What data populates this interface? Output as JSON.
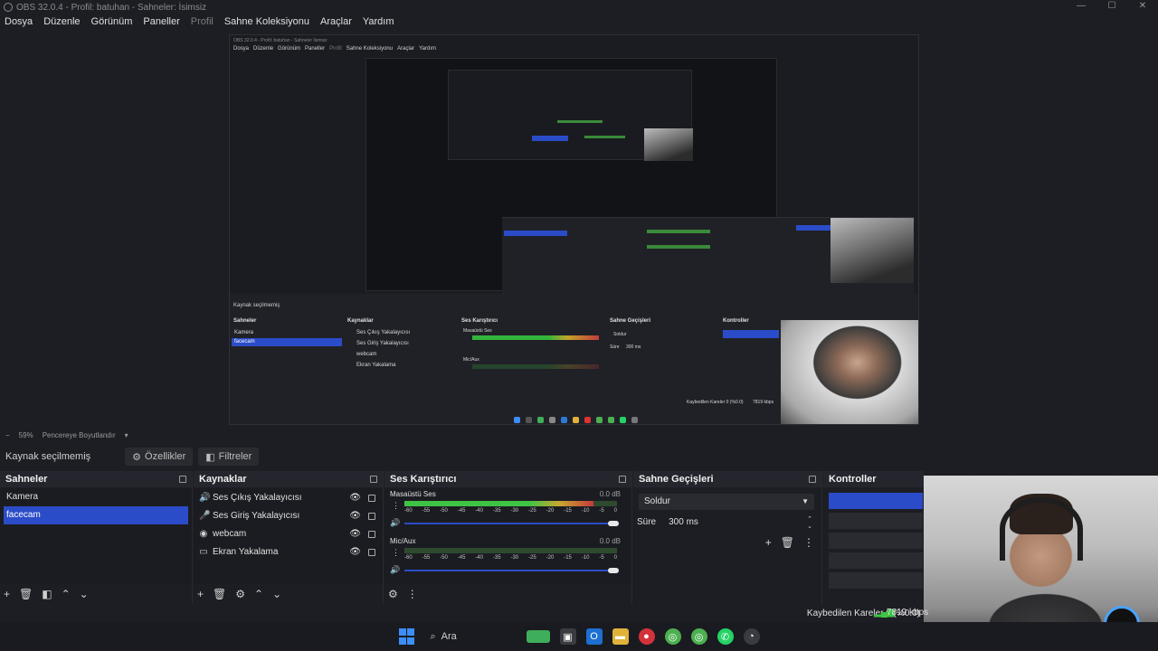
{
  "window": {
    "title": "OBS 32.0.4 - Profil: batuhan - Sahneler: İsimsiz",
    "controls": [
      "—",
      "☐",
      "✕"
    ]
  },
  "menu": {
    "items": [
      "Dosya",
      "Düzenle",
      "Görünüm",
      "Paneller",
      "Profil",
      "Sahne Koleksiyonu",
      "Araçlar",
      "Yardım"
    ]
  },
  "preview": {
    "zoom": "59%",
    "fit_label": "Pencereye Boyutlandır"
  },
  "nested": {
    "title": "OBS 32.0.4 - Profil: batuhan - Sahneler İsimsiz",
    "menu": [
      "Dosya",
      "Düzenle",
      "Görünüm",
      "Paneller",
      "Profil",
      "Sahne Koleksiyonu",
      "Araçlar",
      "Yardım"
    ],
    "context": "Kaynak seçilmemiş",
    "scenes_head": "Sahneler",
    "sources_head": "Kaynaklar",
    "mixer_head": "Ses Karıştırıcı",
    "transitions_head": "Sahne Geçişleri",
    "controls_head": "Kontroller",
    "scenes": [
      "Kamera",
      "facecam"
    ],
    "sources": [
      "Ses Çıkış Yakalayıcısı",
      "Ses Giriş Yakalayıcısı",
      "webcam",
      "Ekran Yakalama"
    ],
    "mixer_ch1": "Masaüstü Ses",
    "mixer_ch2": "Mic/Aux",
    "trans_value": "Soldur",
    "dur_label": "Süre",
    "dur_value": "300 ms",
    "dropped": "Kaybedilen Kareler 0 (%0.0)",
    "kbps": "7819 kbps"
  },
  "context_bar": {
    "label": "Kaynak seçilmemiş",
    "properties_btn": "Özellikler",
    "filters_btn": "Filtreler"
  },
  "scenes": {
    "title": "Sahneler",
    "items": [
      "Kamera",
      "facecam"
    ],
    "selected_index": 1
  },
  "sources": {
    "title": "Kaynaklar",
    "items": [
      {
        "label": "Ses Çıkış Yakalayıcısı",
        "icon": "speaker-icon"
      },
      {
        "label": "Ses Giriş Yakalayıcısı",
        "icon": "microphone-icon"
      },
      {
        "label": "webcam",
        "icon": "camera-icon"
      },
      {
        "label": "Ekran Yakalama",
        "icon": "monitor-icon"
      }
    ]
  },
  "mixer": {
    "title": "Ses Karıştırıcı",
    "channels": [
      {
        "name": "Masaüstü Ses",
        "db": "0.0 dB",
        "level": 0.89
      },
      {
        "name": "Mic/Aux",
        "db": "0.0 dB",
        "level": 0.0
      }
    ],
    "ticks": [
      "-60",
      "-55",
      "-50",
      "-45",
      "-40",
      "-35",
      "-30",
      "-25",
      "-20",
      "-15",
      "-10",
      "-5",
      "0"
    ]
  },
  "transitions": {
    "title": "Sahne Geçişleri",
    "selected": "Soldur",
    "duration_label": "Süre",
    "duration_value": "300 ms"
  },
  "controls": {
    "title": "Kontroller"
  },
  "status": {
    "dropped_frames": "Kaybedilen Kareler 0 (%0.0)",
    "bitrate": "7819 kbps"
  },
  "taskbar": {
    "search_label": "Ara"
  },
  "colors": {
    "accent": "#2b4cc8",
    "background": "#1d1e24",
    "meter_green": "#3fc445",
    "meter_yellow": "#c9a630",
    "meter_red": "#c33b3b"
  }
}
